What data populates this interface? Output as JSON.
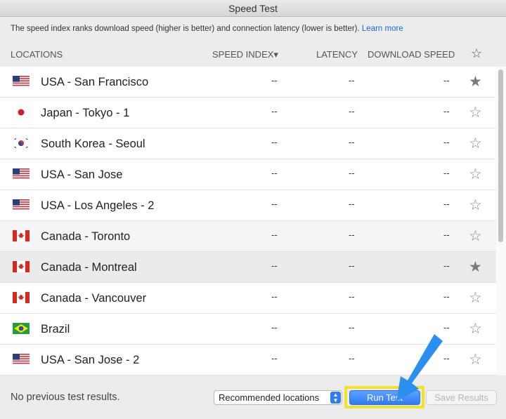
{
  "window": {
    "title": "Speed Test"
  },
  "info": {
    "text": "The speed index ranks download speed (higher is better) and connection latency (lower is better).",
    "link": "Learn more"
  },
  "columns": {
    "locations": "LOCATIONS",
    "speed_index": "SPEED INDEX▾",
    "latency": "LATENCY",
    "download_speed": "DOWNLOAD SPEED",
    "favorite": "☆"
  },
  "rows": [
    {
      "flag": "us",
      "location": "USA - San Francisco",
      "speed": "--",
      "latency": "--",
      "download": "--",
      "favorite": "★"
    },
    {
      "flag": "jp",
      "location": "Japan - Tokyo - 1",
      "speed": "--",
      "latency": "--",
      "download": "--",
      "favorite": "☆"
    },
    {
      "flag": "kr",
      "location": "South Korea - Seoul",
      "speed": "--",
      "latency": "--",
      "download": "--",
      "favorite": "☆"
    },
    {
      "flag": "us",
      "location": "USA - San Jose",
      "speed": "--",
      "latency": "--",
      "download": "--",
      "favorite": "☆"
    },
    {
      "flag": "us",
      "location": "USA - Los Angeles - 2",
      "speed": "--",
      "latency": "--",
      "download": "--",
      "favorite": "☆"
    },
    {
      "flag": "ca",
      "location": "Canada - Toronto",
      "speed": "--",
      "latency": "--",
      "download": "--",
      "favorite": "☆"
    },
    {
      "flag": "ca",
      "location": "Canada - Montreal",
      "speed": "--",
      "latency": "--",
      "download": "--",
      "favorite": "★"
    },
    {
      "flag": "ca",
      "location": "Canada - Vancouver",
      "speed": "--",
      "latency": "--",
      "download": "--",
      "favorite": "☆"
    },
    {
      "flag": "br",
      "location": "Brazil",
      "speed": "--",
      "latency": "--",
      "download": "--",
      "favorite": "☆"
    },
    {
      "flag": "us",
      "location": "USA - San Jose - 2",
      "speed": "--",
      "latency": "--",
      "download": "--",
      "favorite": "☆"
    }
  ],
  "footer": {
    "status": "No previous test results.",
    "select_value": "Recommended locations",
    "run_button": "Run Test",
    "save_button": "Save Results"
  },
  "colors": {
    "accent": "#2e7bf6",
    "highlight": "#f1e22c",
    "arrow": "#2b8ff0"
  }
}
